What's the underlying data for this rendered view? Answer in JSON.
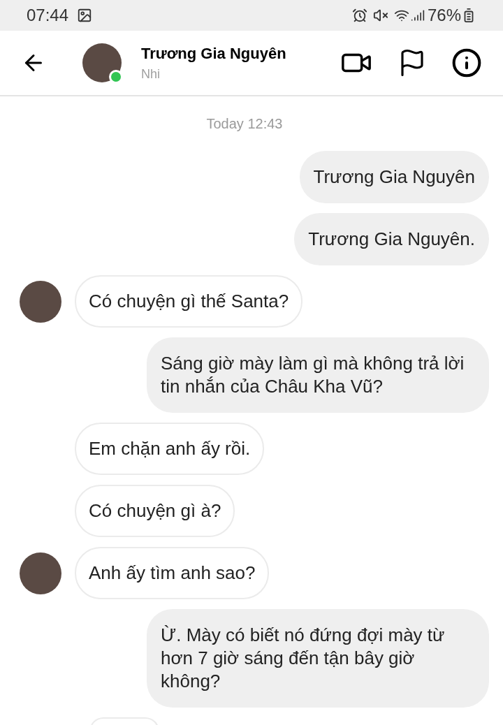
{
  "status_bar": {
    "time": "07:44",
    "battery": "76%"
  },
  "header": {
    "name": "Trương Gia Nguyên",
    "subtitle": "Nhi",
    "online": true
  },
  "timestamp": "Today 12:43",
  "messages": [
    {
      "kind": "out",
      "text": "Trương Gia Nguyên"
    },
    {
      "kind": "out",
      "text": "Trương Gia Nguyên."
    },
    {
      "kind": "in",
      "text": "Có chuyện gì thế Santa?",
      "avatar": true
    },
    {
      "kind": "out",
      "text": "Sáng giờ mày làm gì mà không trả lời tin nhắn của Châu Kha Vũ?"
    },
    {
      "kind": "in",
      "text": "Em chặn anh ấy rồi.",
      "avatar": false
    },
    {
      "kind": "in",
      "text": "Có chuyện gì à?",
      "avatar": false
    },
    {
      "kind": "in",
      "text": "Anh ấy tìm anh sao?",
      "avatar": true
    },
    {
      "kind": "out",
      "text": "Ừ. Mày có biết nó đứng đợi mày từ hơn 7 giờ sáng đến tận bây giờ không?"
    },
    {
      "kind": "in_cut"
    }
  ]
}
